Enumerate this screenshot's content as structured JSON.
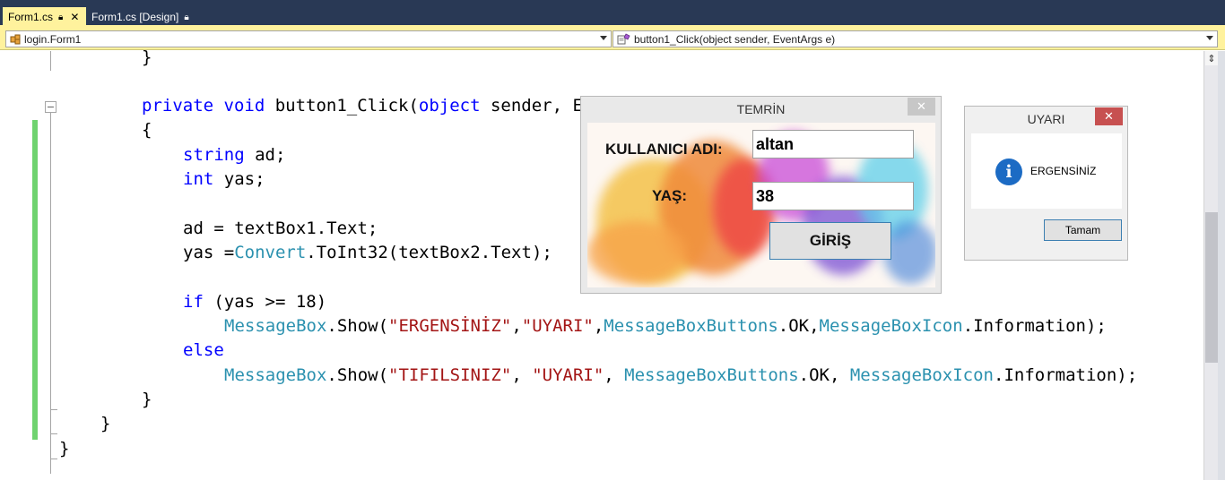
{
  "tabs": [
    {
      "label": "Form1.cs",
      "active": true
    },
    {
      "label": "Form1.cs [Design]",
      "active": false
    }
  ],
  "navigation": {
    "class_combo": "login.Form1",
    "member_combo": "button1_Click(object sender, EventArgs e)"
  },
  "code": {
    "line1": "}",
    "line2": {
      "kw": "private void",
      "name": "button1_Click(",
      "kw2": "object",
      "rest": " sender, E"
    },
    "line3": "{",
    "line4": {
      "kw": "string",
      "rest": " ad;"
    },
    "line5": {
      "kw": "int",
      "rest": " yas;"
    },
    "line7": "ad = textBox1.Text;",
    "line8": {
      "pre": "yas =",
      "type": "Convert",
      "rest": ".ToInt32(textBox2.Text);"
    },
    "line10": {
      "kw": "if",
      "rest": " (yas >= 18)"
    },
    "line11": {
      "t1": "MessageBox",
      "m1": ".Show(",
      "s1": "\"ERGENSİNİZ\"",
      "c1": ",",
      "s2": "\"UYARI\"",
      "c2": ",",
      "t2": "MessageBoxButtons",
      "m2": ".OK,",
      "t3": "MessageBoxIcon",
      "m3": ".Information);"
    },
    "line12": "else",
    "line13": {
      "t1": "MessageBox",
      "m1": ".Show(",
      "s1": "\"TIFILSINIZ\"",
      "c1": ", ",
      "s2": "\"UYARI\"",
      "c2": ", ",
      "t2": "MessageBoxButtons",
      "m2": ".OK, ",
      "t3": "MessageBoxIcon",
      "m3": ".Information);"
    },
    "line14": "}",
    "line15": "}",
    "line16": "}"
  },
  "form": {
    "title": "TEMRİN",
    "username_label": "KULLANICI ADI:",
    "username_value": "altan",
    "age_label": "YAŞ:",
    "age_value": "38",
    "submit_label": "GİRİŞ"
  },
  "messagebox": {
    "title": "UYARI",
    "icon": "information-icon",
    "message": "ERGENSİNİZ",
    "ok_label": "Tamam"
  },
  "colors": {
    "keyword": "#0000ff",
    "type": "#2b91af",
    "string": "#a31515",
    "tab_active": "#fff29d",
    "tab_strip": "#293955",
    "change_bar": "#6fd36f"
  }
}
